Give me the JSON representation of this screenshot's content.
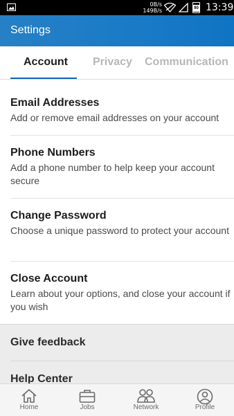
{
  "status_bar": {
    "net_down": "0B/s",
    "net_up": "149B/s",
    "battery": "90",
    "time": "13:39"
  },
  "app_bar": {
    "title": "Settings"
  },
  "tabs": [
    {
      "label": "Account",
      "active": true
    },
    {
      "label": "Privacy",
      "active": false
    },
    {
      "label": "Communication",
      "active": false
    }
  ],
  "settings_items": [
    {
      "title": "Email Addresses",
      "description": "Add or remove email addresses on your account"
    },
    {
      "title": "Phone Numbers",
      "description": "Add a phone number to help keep your account secure"
    },
    {
      "title": "Change Password",
      "description": "Choose a unique password to protect your account"
    },
    {
      "title": "Close Account",
      "description": "Learn about your options, and close your account if you wish"
    }
  ],
  "extra_items": [
    {
      "title": "Give feedback"
    },
    {
      "title": "Help Center"
    }
  ],
  "bottom_nav": [
    {
      "label": "Home",
      "icon": "home-icon"
    },
    {
      "label": "Jobs",
      "icon": "briefcase-icon"
    },
    {
      "label": "Network",
      "icon": "people-icon"
    },
    {
      "label": "Profile",
      "icon": "profile-icon"
    }
  ],
  "colors": {
    "accent": "#0a66c2",
    "app_bar": "#1a7ac6",
    "inactive_tab": "#b7b7b7"
  }
}
